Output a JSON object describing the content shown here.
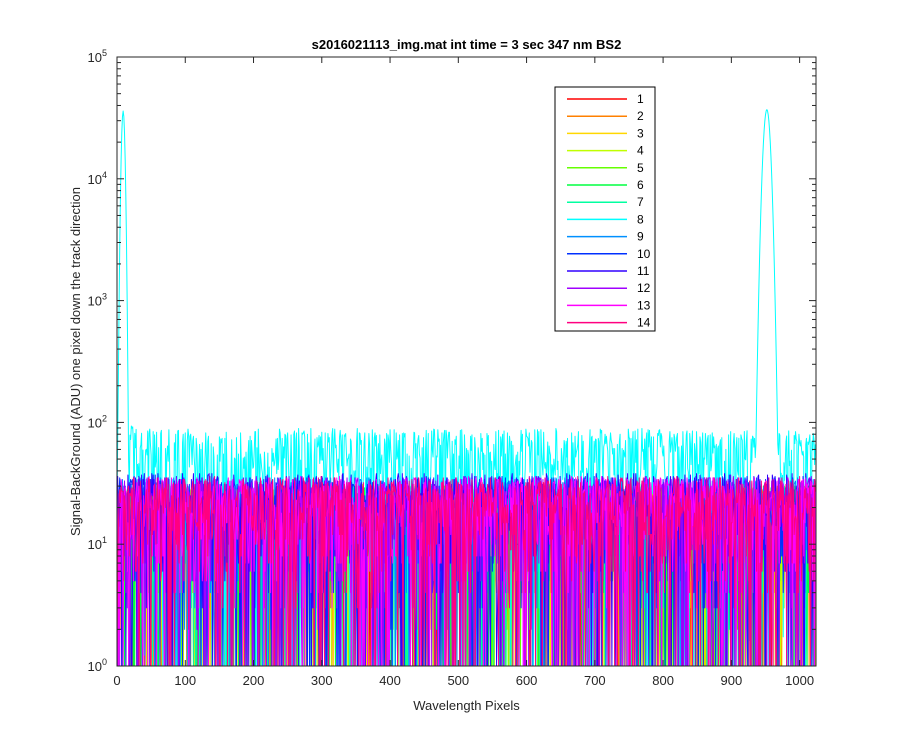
{
  "chart_data": {
    "type": "line",
    "title": "s2016021113_img.mat int time = 3 sec  347 nm BS2",
    "xlabel": "Wavelength Pixels",
    "ylabel": "Signal-BackGround (ADU) one pixel down the track direction",
    "xlim": [
      0,
      1024
    ],
    "ylim": [
      1,
      100000
    ],
    "yscale": "log",
    "x_ticks": [
      "0",
      "100",
      "200",
      "300",
      "400",
      "500",
      "600",
      "700",
      "800",
      "900",
      "1000"
    ],
    "x_tick_values": [
      0,
      100,
      200,
      300,
      400,
      500,
      600,
      700,
      800,
      900,
      1000
    ],
    "y_ticks": [
      {
        "base": "10",
        "exp": "0",
        "value": 1
      },
      {
        "base": "10",
        "exp": "1",
        "value": 10
      },
      {
        "base": "10",
        "exp": "2",
        "value": 100
      },
      {
        "base": "10",
        "exp": "3",
        "value": 1000
      },
      {
        "base": "10",
        "exp": "4",
        "value": 10000
      },
      {
        "base": "10",
        "exp": "5",
        "value": 100000
      }
    ],
    "legend_position": "top-right",
    "grid": false,
    "series": [
      {
        "name": "1",
        "color": "#ff0000",
        "noise_level": 12
      },
      {
        "name": "2",
        "color": "#ff8000",
        "noise_level": 12
      },
      {
        "name": "3",
        "color": "#ffd700",
        "noise_level": 12
      },
      {
        "name": "4",
        "color": "#c0ff00",
        "noise_level": 12
      },
      {
        "name": "5",
        "color": "#66ff00",
        "noise_level": 12
      },
      {
        "name": "6",
        "color": "#00ff40",
        "noise_level": 12
      },
      {
        "name": "7",
        "color": "#00ffa0",
        "noise_level": 12
      },
      {
        "name": "8",
        "color": "#00ffff",
        "noise_level": 35,
        "peaks": [
          {
            "x": 9,
            "value": 36000,
            "width": 2.2
          },
          {
            "x": 952,
            "value": 37000,
            "width": 4.5
          }
        ]
      },
      {
        "name": "9",
        "color": "#0090ff",
        "noise_level": 14
      },
      {
        "name": "10",
        "color": "#0030ff",
        "noise_level": 14
      },
      {
        "name": "11",
        "color": "#3000ff",
        "noise_level": 15
      },
      {
        "name": "12",
        "color": "#a000ff",
        "noise_level": 14
      },
      {
        "name": "13",
        "color": "#ff00ff",
        "noise_level": 14
      },
      {
        "name": "14",
        "color": "#ff0080",
        "noise_level": 14
      }
    ]
  }
}
